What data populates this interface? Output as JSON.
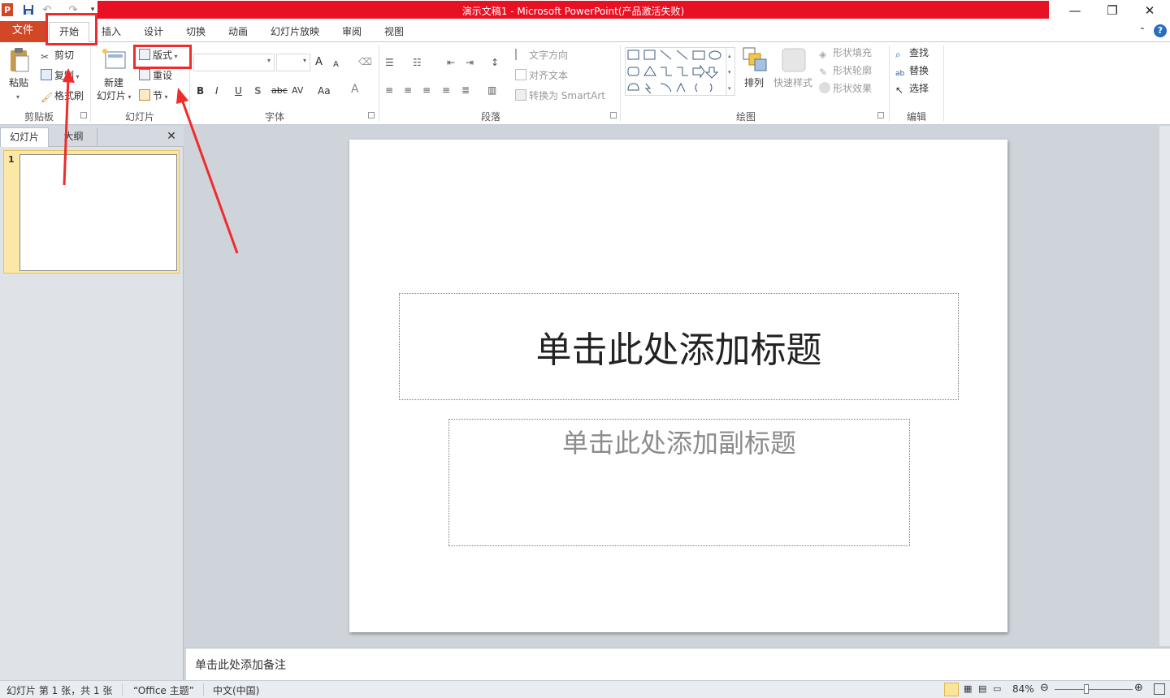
{
  "window": {
    "title": "演示文稿1 - Microsoft PowerPoint(产品激活失败)",
    "minimize_glyph": "—",
    "restore_glyph": "❐",
    "close_glyph": "✕"
  },
  "tabs": {
    "file": "文件",
    "home": "开始",
    "insert": "插入",
    "design": "设计",
    "transitions": "切换",
    "animations": "动画",
    "slideshow": "幻灯片放映",
    "review": "审阅",
    "view": "视图"
  },
  "ribbon": {
    "clipboard": {
      "group": "剪贴板",
      "paste": "粘贴",
      "cut": "剪切",
      "copy": "复制",
      "format_painter": "格式刷"
    },
    "slides": {
      "group": "幻灯片",
      "new_slide_line1": "新建",
      "new_slide_line2": "幻灯片",
      "layout": "版式",
      "reset": "重设",
      "section": "节"
    },
    "font": {
      "group": "字体",
      "bold": "B",
      "italic": "I",
      "underline": "U",
      "shadow": "S",
      "strike": "abc",
      "spacing": "AV",
      "case": "Aa",
      "color": "A",
      "grow": "A",
      "shrink": "A"
    },
    "paragraph": {
      "group": "段落",
      "text_direction": "文字方向",
      "align_text": "对齐文本",
      "smartart": "转换为 SmartArt"
    },
    "drawing": {
      "group": "绘图",
      "arrange": "排列",
      "quick_styles": "快速样式",
      "shape_fill": "形状填充",
      "shape_outline": "形状轮廓",
      "shape_effects": "形状效果"
    },
    "editing": {
      "group": "编辑",
      "find": "查找",
      "replace": "替换",
      "select": "选择"
    }
  },
  "panel": {
    "slides_tab": "幻灯片",
    "outline_tab": "大纲",
    "close_glyph": "✕",
    "slide_number": "1"
  },
  "slide": {
    "title_placeholder": "单击此处添加标题",
    "subtitle_placeholder": "单击此处添加副标题"
  },
  "notes": {
    "placeholder": "单击此处添加备注"
  },
  "status": {
    "slide_info": "幻灯片 第 1 张，共 1 张",
    "theme": "“Office 主题”",
    "language": "中文(中国)",
    "zoom": "84%"
  },
  "colors": {
    "title_bar": "#e81123",
    "file_tab": "#d24726",
    "annotation": "#ee2c2c",
    "thumbnail_highlight": "#fbe7a6"
  }
}
